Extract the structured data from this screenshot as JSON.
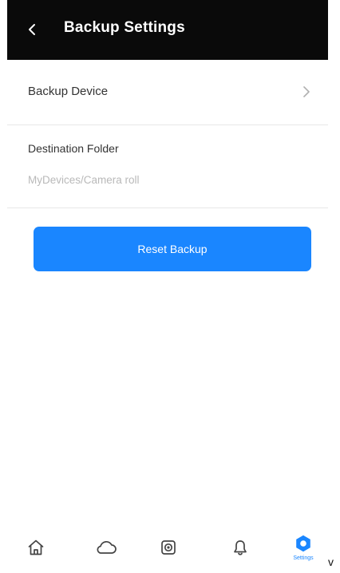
{
  "header": {
    "title": "Backup Settings",
    "back_icon": "chevron-left-icon"
  },
  "settings": {
    "backup_device_label": "Backup Device",
    "destination_folder_label": "Destination Folder",
    "destination_folder_value": "MyDevices/Camera roll"
  },
  "actions": {
    "reset_label": "Reset Backup"
  },
  "tabbar": {
    "items": [
      {
        "icon": "home-icon",
        "label": ""
      },
      {
        "icon": "cloud-icon",
        "label": ""
      },
      {
        "icon": "camera-icon",
        "label": ""
      },
      {
        "icon": "bell-icon",
        "label": ""
      },
      {
        "icon": "settings-gear-icon",
        "label": "Settings",
        "active": true
      }
    ]
  },
  "stray_text": "v",
  "colors": {
    "header_bg": "#0a0a0a",
    "accent": "#1a86ff",
    "text": "#333333",
    "muted": "#b9b9b9",
    "divider": "#e7e7e7"
  }
}
